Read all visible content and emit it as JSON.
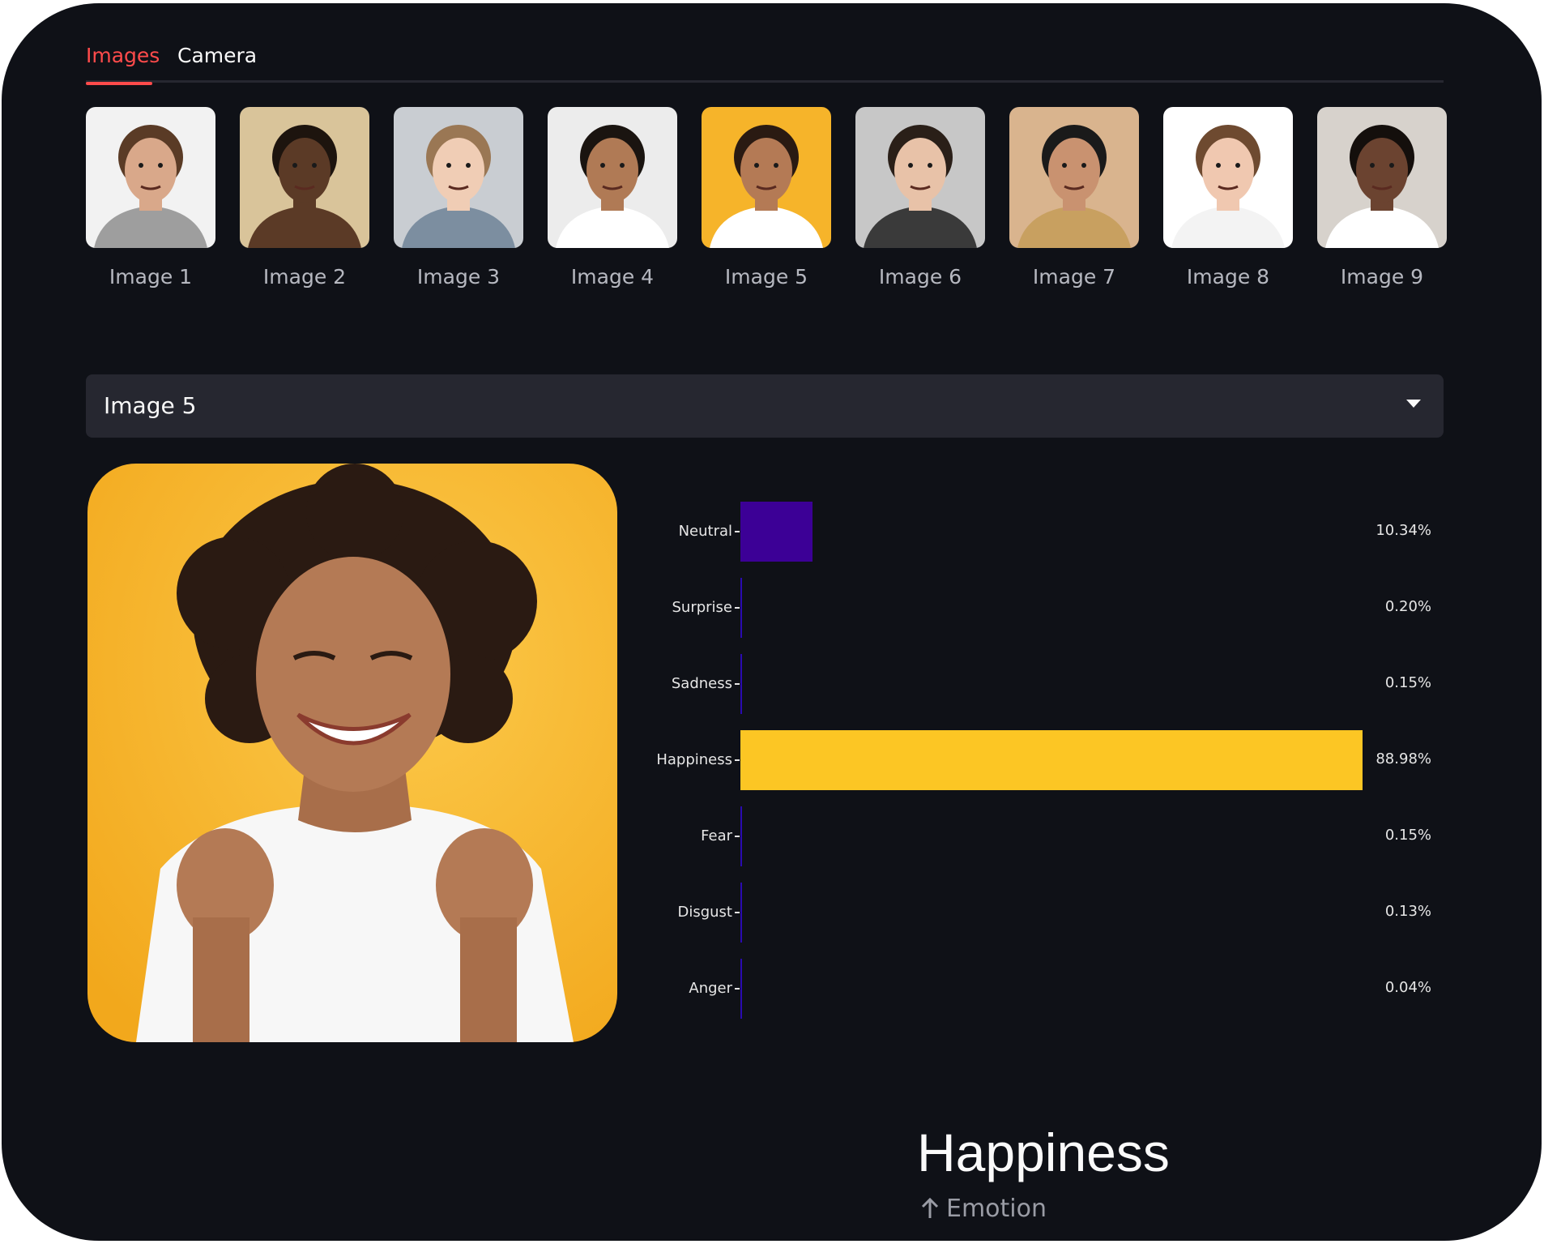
{
  "tabs": [
    {
      "label": "Images",
      "active": true
    },
    {
      "label": "Camera",
      "active": false
    }
  ],
  "thumbnails": [
    {
      "label": "Image 1",
      "bg": "#f2f2f2",
      "skin": "#d9a88a",
      "hair": "#5a3b26",
      "shirt": "#9e9e9e"
    },
    {
      "label": "Image 2",
      "bg": "#d9c49a",
      "skin": "#5b3a26",
      "hair": "#1d140e",
      "shirt": "#5b3a26"
    },
    {
      "label": "Image 3",
      "bg": "#c9cdd2",
      "skin": "#f0cdb5",
      "hair": "#9a7754",
      "shirt": "#7c8ea0"
    },
    {
      "label": "Image 4",
      "bg": "#ececec",
      "skin": "#b07a55",
      "hair": "#1a1410",
      "shirt": "#ffffff"
    },
    {
      "label": "Image 5",
      "bg": "#f6b42a",
      "skin": "#b47a55",
      "hair": "#2a1a12",
      "shirt": "#ffffff"
    },
    {
      "label": "Image 6",
      "bg": "#c7c7c7",
      "skin": "#e8c2a8",
      "hair": "#2a1f18",
      "shirt": "#3a3a3a"
    },
    {
      "label": "Image 7",
      "bg": "#d9b48e",
      "skin": "#c99270",
      "hair": "#1a1a1a",
      "shirt": "#c8a060"
    },
    {
      "label": "Image 8",
      "bg": "#ffffff",
      "skin": "#f0c8b0",
      "hair": "#6e4a30",
      "shirt": "#f3f3f3"
    },
    {
      "label": "Image 9",
      "bg": "#d7d2cc",
      "skin": "#6b4330",
      "hair": "#140f0c",
      "shirt": "#ffffff"
    }
  ],
  "select": {
    "value": "Image 5"
  },
  "chart_data": {
    "type": "bar",
    "orientation": "horizontal",
    "categories": [
      "Neutral",
      "Surprise",
      "Sadness",
      "Happiness",
      "Fear",
      "Disgust",
      "Anger"
    ],
    "values": [
      10.34,
      0.2,
      0.15,
      88.98,
      0.15,
      0.13,
      0.04
    ],
    "value_labels": [
      "10.34%",
      "0.20%",
      "0.15%",
      "88.98%",
      "0.15%",
      "0.13%",
      "0.04%"
    ],
    "xlim": [
      0,
      88.98
    ],
    "colors": [
      "#3c0096",
      "#2a0ab0",
      "#2a0ab0",
      "#fcc624",
      "#2a0ab0",
      "#2a0ab0",
      "#2a0ab0"
    ],
    "grid": false,
    "title": "",
    "xlabel": "",
    "ylabel": ""
  },
  "result": {
    "title": "Happiness",
    "subtitle": "Emotion",
    "delta_icon": "arrow-up-icon"
  }
}
